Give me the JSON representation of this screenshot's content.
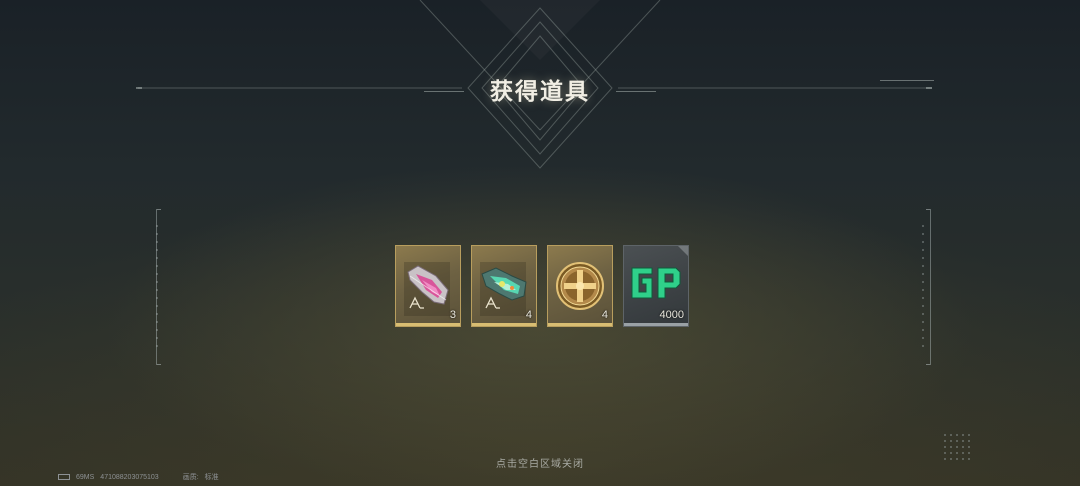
{
  "dialog": {
    "title": "获得道具",
    "close_hint": "点击空白区域关闭"
  },
  "items": [
    {
      "icon": "pink-weapon-icon",
      "count": "3",
      "frame": "gold"
    },
    {
      "icon": "green-weapon-icon",
      "count": "4",
      "frame": "gold"
    },
    {
      "icon": "gold-medallion-icon",
      "count": "4",
      "frame": "gold"
    },
    {
      "icon": "gp-currency-icon",
      "count": "4000",
      "frame": "gray"
    }
  ],
  "status": {
    "latency": "69MS",
    "uid": "471088203075103",
    "quality_label": "画质:",
    "quality_value": "标准"
  },
  "colors": {
    "gold_frame": "#b89e5e",
    "gold_bar": "#d8bd72",
    "gp_green": "#2fd08a"
  }
}
